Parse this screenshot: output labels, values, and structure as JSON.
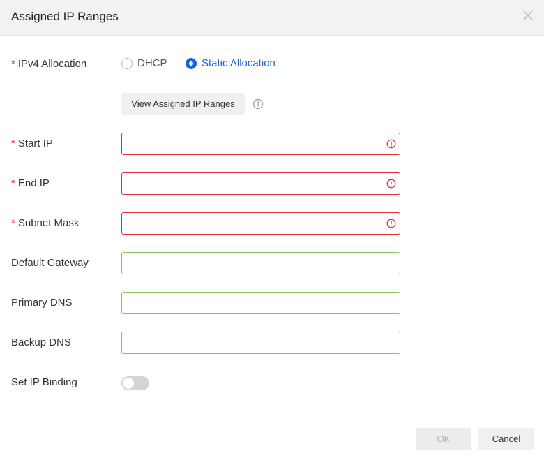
{
  "dialog": {
    "title": "Assigned IP Ranges",
    "close_icon": "close-icon"
  },
  "ipv4": {
    "required_mark": "*",
    "label": "IPv4 Allocation",
    "options": [
      {
        "label": "DHCP",
        "checked": false
      },
      {
        "label": "Static Allocation",
        "checked": true
      }
    ]
  },
  "view_button": {
    "label": "View Assigned IP Ranges",
    "help_icon": "help-icon"
  },
  "fields": {
    "start_ip": {
      "required_mark": "*",
      "label": "Start IP",
      "value": "",
      "state": "error"
    },
    "end_ip": {
      "required_mark": "*",
      "label": "End IP",
      "value": "",
      "state": "error"
    },
    "subnet_mask": {
      "required_mark": "*",
      "label": "Subnet Mask",
      "value": "",
      "state": "error"
    },
    "default_gateway": {
      "label": "Default Gateway",
      "value": "",
      "state": "valid"
    },
    "primary_dns": {
      "label": "Primary DNS",
      "value": "",
      "state": "valid"
    },
    "backup_dns": {
      "label": "Backup DNS",
      "value": "",
      "state": "valid"
    }
  },
  "ip_binding": {
    "label": "Set IP Binding",
    "enabled": false
  },
  "footer": {
    "ok_label": "OK",
    "cancel_label": "Cancel"
  },
  "colors": {
    "accent": "#1664d9",
    "error": "#e0303a",
    "valid": "#86c35b"
  }
}
